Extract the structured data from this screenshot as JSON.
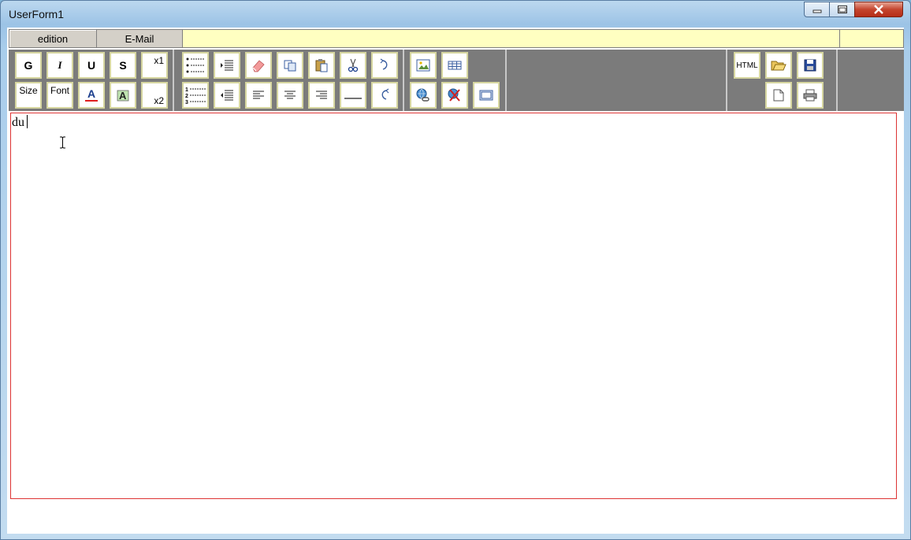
{
  "window": {
    "title": "UserForm1",
    "controls": {
      "minimize_icon": "minimize-icon",
      "maximize_icon": "maximize-icon",
      "close_icon": "close-icon"
    }
  },
  "tabs": [
    {
      "label": "edition"
    },
    {
      "label": "E-Mail"
    }
  ],
  "toolbar": {
    "bold_label": "G",
    "italic_label": "I",
    "underline_label": "U",
    "strike_label": "S",
    "superscript_label": "x1",
    "size_label": "Size",
    "font_label": "Font",
    "subscript_label": "x2",
    "html_label": "HTML"
  },
  "editor": {
    "text": "du"
  },
  "colors": {
    "tab_bar_bg": "#ffffc1",
    "toolbar_bg": "#7b7b7b",
    "editor_border": "#dd3333",
    "button_border": "#d6d6a0"
  }
}
